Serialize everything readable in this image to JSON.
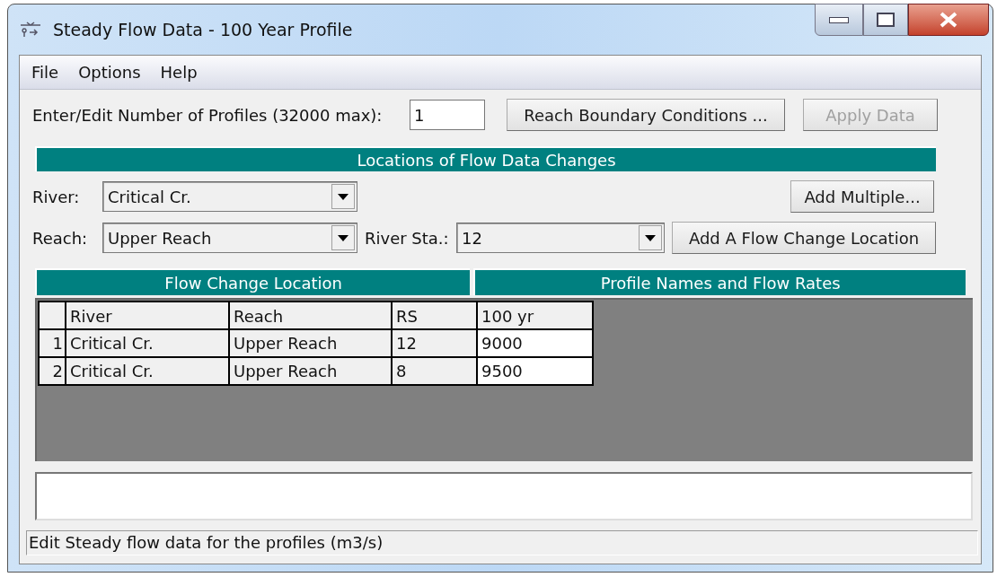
{
  "window": {
    "title": "Steady Flow Data - 100 Year Profile"
  },
  "menu": [
    "File",
    "Options",
    "Help"
  ],
  "profiles": {
    "label": "Enter/Edit Number of Profiles (32000 max):",
    "value": "1"
  },
  "top_buttons": [
    {
      "label": "Reach Boundary Conditions ...",
      "disabled": false
    },
    {
      "label": "Apply Data",
      "disabled": true
    }
  ],
  "locations": {
    "title": "Locations of Flow Data Changes",
    "river": {
      "label": "River:",
      "value": "Critical Cr."
    },
    "reach": {
      "label": "Reach:",
      "value": "Upper Reach"
    },
    "river_sta": {
      "label": "River Sta.:",
      "value": "12"
    },
    "add_multiple": "Add Multiple...",
    "add_location": "Add A Flow Change Location"
  },
  "table": {
    "group_headers": [
      "Flow Change Location",
      "Profile Names and Flow Rates"
    ],
    "columns": [
      "River",
      "Reach",
      "RS",
      "100 yr"
    ],
    "rows": [
      {
        "index": "1",
        "cells": [
          "Critical Cr.",
          "Upper Reach",
          "12",
          "9000"
        ]
      },
      {
        "index": "2",
        "cells": [
          "Critical Cr.",
          "Upper Reach",
          "8",
          "9500"
        ]
      }
    ]
  },
  "status_bar": "Edit Steady flow data for the profiles (m3/s)"
}
